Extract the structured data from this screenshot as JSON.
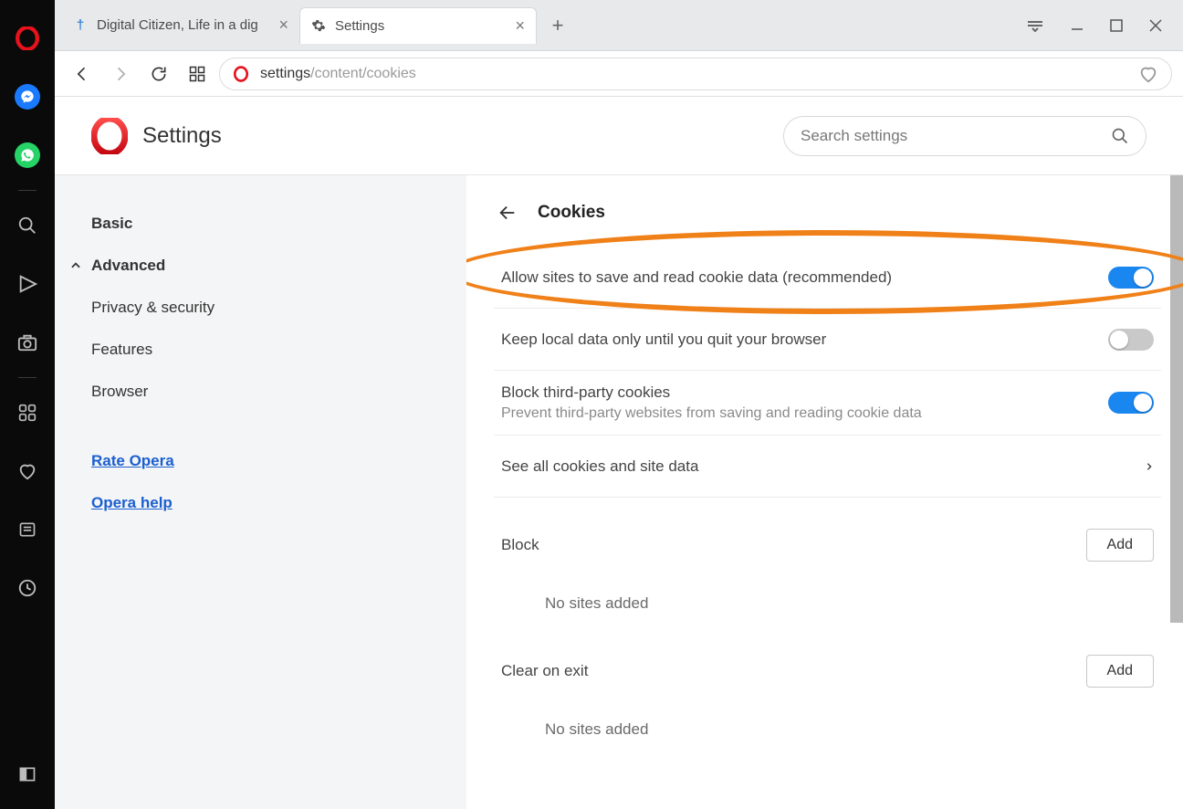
{
  "tabs": {
    "inactive": {
      "label": "Digital Citizen, Life in a dig"
    },
    "active": {
      "label": "Settings"
    }
  },
  "address": {
    "prefix": "settings",
    "suffix": "/content/cookies"
  },
  "settings_title": "Settings",
  "search": {
    "placeholder": "Search settings"
  },
  "nav": {
    "basic": "Basic",
    "advanced": "Advanced",
    "privacy": "Privacy & security",
    "features": "Features",
    "browser": "Browser",
    "rate": "Rate Opera",
    "help": "Opera help"
  },
  "content": {
    "section": "Cookies",
    "row1": "Allow sites to save and read cookie data (recommended)",
    "row2": "Keep local data only until you quit your browser",
    "row3_title": "Block third-party cookies",
    "row3_sub": "Prevent third-party websites from saving and reading cookie data",
    "row4": "See all cookies and site data",
    "block_heading": "Block",
    "add_btn": "Add",
    "empty": "No sites added",
    "clear_heading": "Clear on exit",
    "empty2": "No sites added"
  }
}
